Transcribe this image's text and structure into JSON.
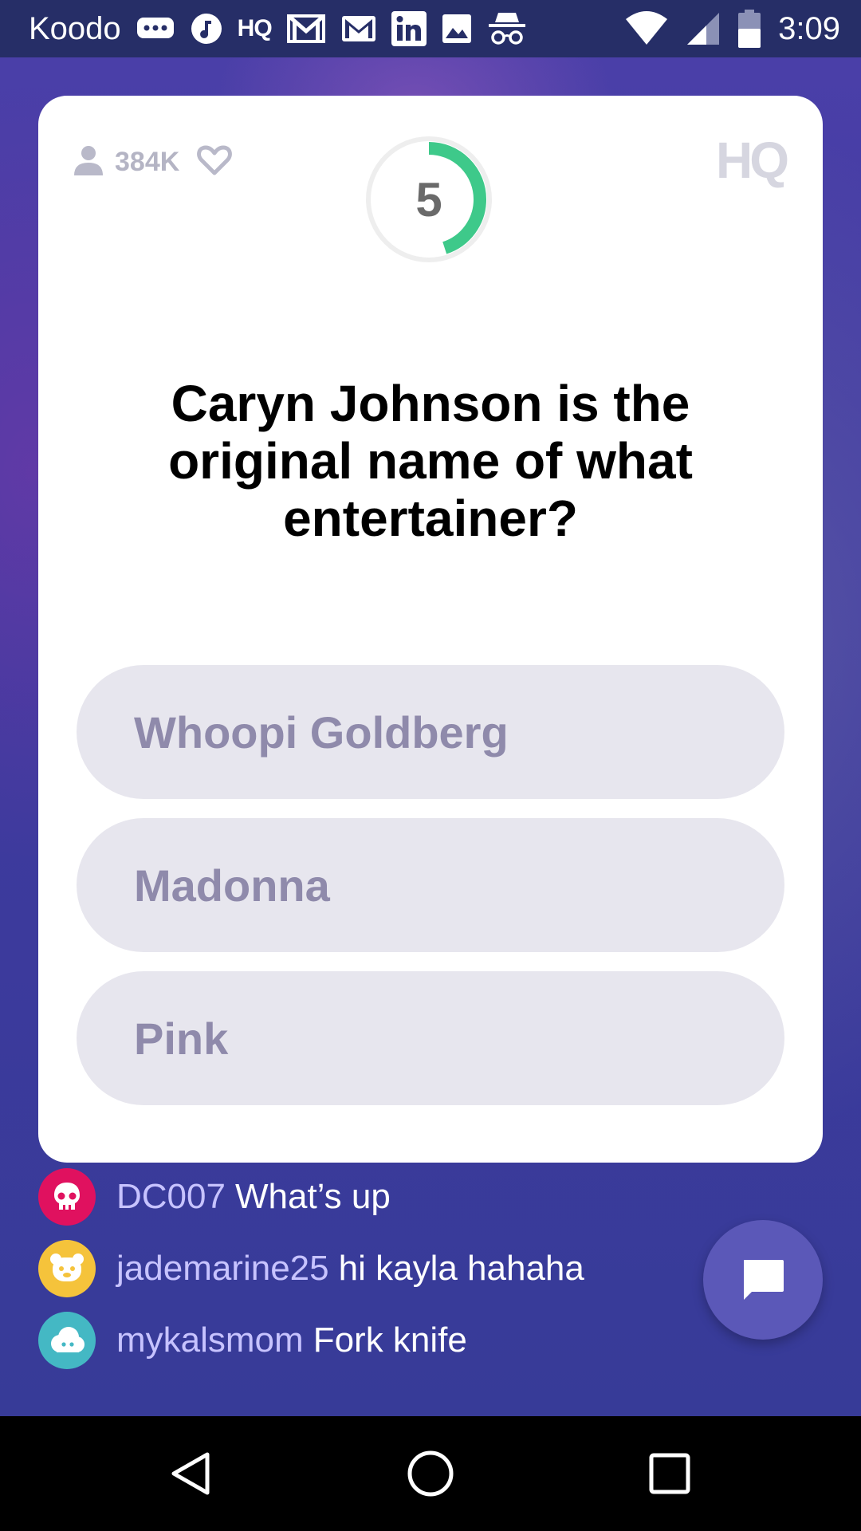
{
  "status_bar": {
    "carrier": "Koodo",
    "time": "3:09",
    "notification_icons": [
      "message-icon",
      "music-icon",
      "hq-icon",
      "gmail-icon",
      "gmail-icon",
      "linkedin-icon",
      "image-icon",
      "incognito-icon"
    ],
    "hq_icon_text": "HQ"
  },
  "header": {
    "viewer_count": "384K",
    "timer_value": "5",
    "timer_progress": 0.45,
    "logo": "HQ"
  },
  "question": {
    "text": "Caryn Johnson is the original name of what entertainer?"
  },
  "answers": [
    {
      "label": "Whoopi Goldberg"
    },
    {
      "label": "Madonna"
    },
    {
      "label": "Pink"
    }
  ],
  "chat": [
    {
      "username": "DC007",
      "message": "What’s up",
      "avatar_color": "#e0115f",
      "avatar_icon": "skull-icon"
    },
    {
      "username": "jademarine25",
      "message": "hi kayla hahaha",
      "avatar_color": "#f5c33b",
      "avatar_icon": "bear-icon"
    },
    {
      "username": "mykalsmom",
      "message": "Fork knife",
      "avatar_color": "#44b8c4",
      "avatar_icon": "cloud-icon"
    }
  ],
  "colors": {
    "card": "#ffffff",
    "answer_bg": "#e7e6ee",
    "answer_text": "#8f8aab",
    "timer_arc": "#3ec98a",
    "chat_button": "#5b58b8"
  }
}
